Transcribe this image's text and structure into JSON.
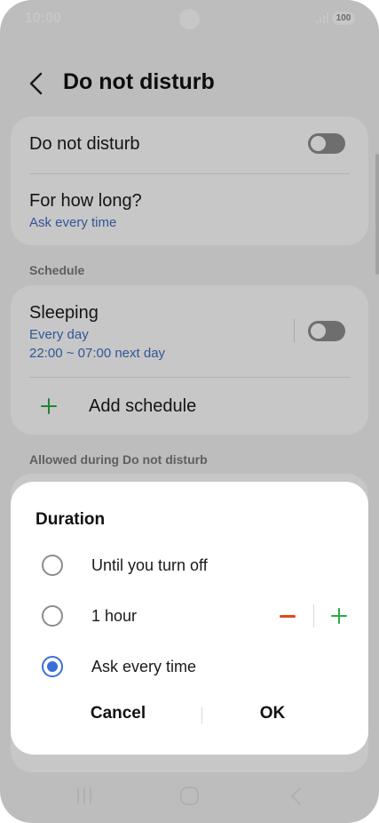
{
  "status_bar": {
    "time": "10:00",
    "battery": "100"
  },
  "header": {
    "title": "Do not disturb",
    "back_icon": "chevron-left-icon"
  },
  "dnd_card": {
    "dnd_label": "Do not disturb",
    "dnd_toggle_on": false,
    "how_long_label": "For how long?",
    "how_long_value": "Ask every time"
  },
  "schedule_section": {
    "label": "Schedule",
    "sleeping_label": "Sleeping",
    "sleeping_days": "Every day",
    "sleeping_time": "22:00 ~ 07:00 next day",
    "sleeping_toggle_on": false,
    "add_schedule_label": "Add schedule"
  },
  "allowed_section": {
    "label": "Allowed during Do not disturb"
  },
  "dialog": {
    "title": "Duration",
    "options": [
      {
        "label": "Until you turn off",
        "selected": false
      },
      {
        "label": "1 hour",
        "selected": false
      },
      {
        "label": "Ask every time",
        "selected": true
      }
    ],
    "cancel_label": "Cancel",
    "ok_label": "OK"
  },
  "colors": {
    "accent": "#3b6fd8",
    "link": "#3f6fd4",
    "minus": "#e2471e",
    "plus": "#2aa84a"
  }
}
